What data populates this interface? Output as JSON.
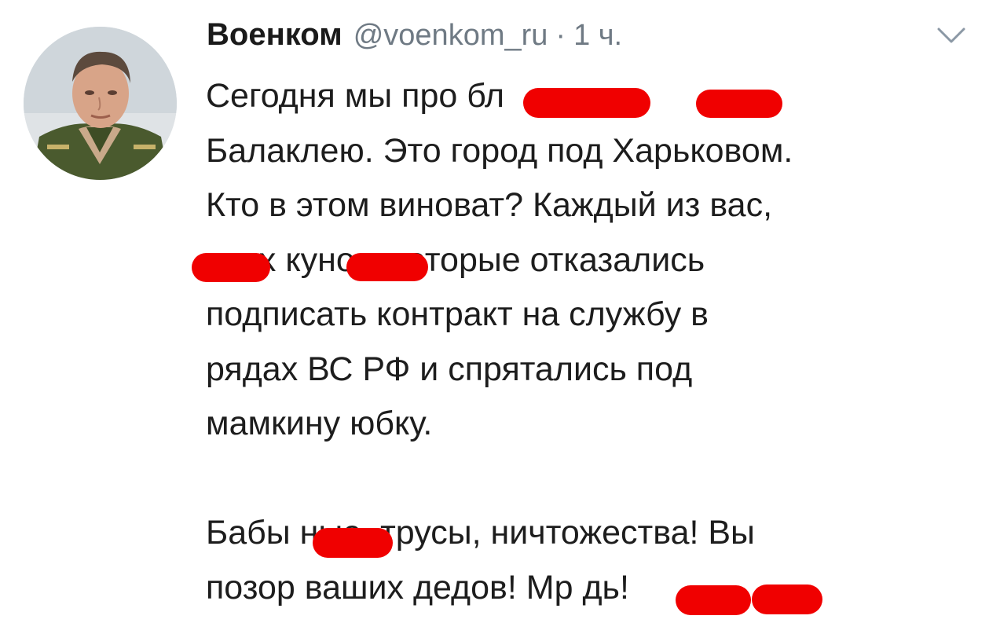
{
  "author": {
    "display_name": "Военком",
    "handle": "@voenkom_ru",
    "separator": "·",
    "time": "1 ч."
  },
  "icons": {
    "avatar": "avatar-photo",
    "menu": "chevron-down-icon"
  },
  "tweet": {
    "lines": [
      "Сегодня мы про         бл",
      "Балаклею. Это город под Харьковом.",
      "Кто в этом виноват? Каждый из вас,",
      "   учих       кунов, которые отказались",
      "подписать контракт на службу в",
      "рядах ВС РФ и спрятались под",
      "мамкину юбку.",
      "Бабы       ные, трусы, ничтожества! Вы",
      "позор ваших дедов! Мр         дь!"
    ]
  },
  "colors": {
    "redaction": "#f00000",
    "secondary_text": "#6f7a84",
    "primary_text": "#1d1d1d"
  }
}
